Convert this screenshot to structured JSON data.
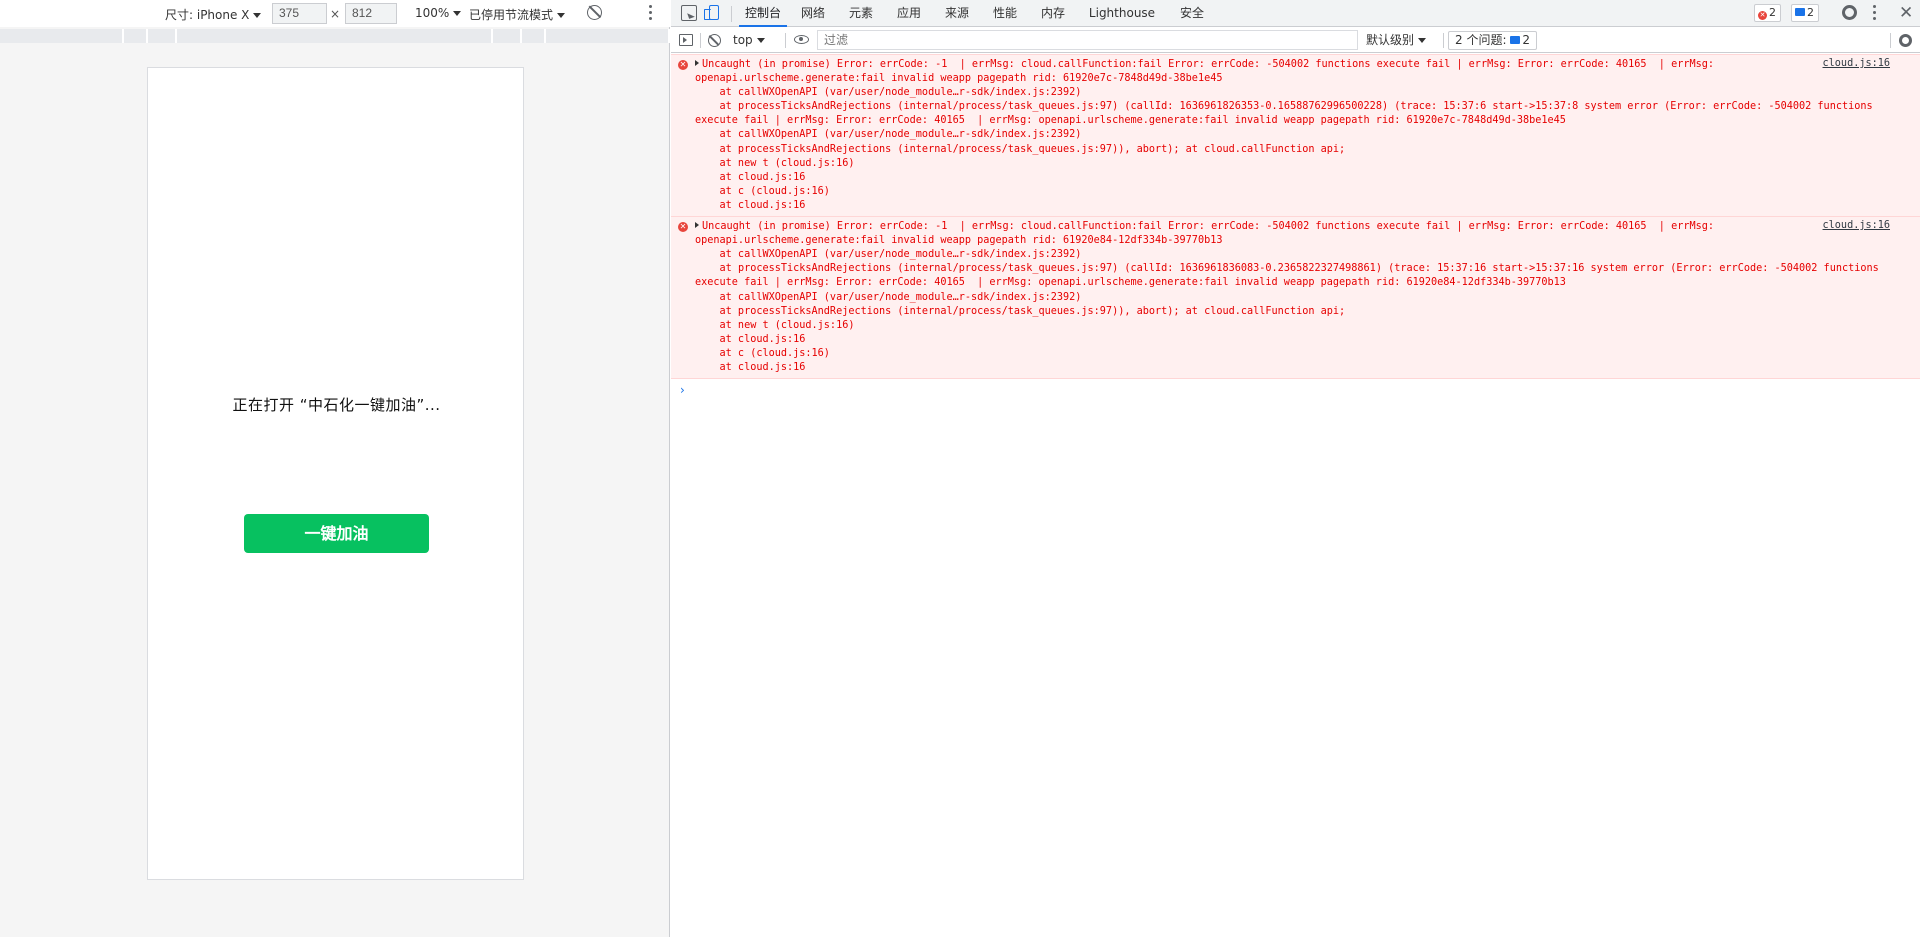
{
  "device_toolbar": {
    "dimensions_label": "尺寸: iPhone X",
    "width": "375",
    "height": "812",
    "times": "×",
    "zoom": "100%",
    "throttle": "已停用节流模式"
  },
  "phone": {
    "loading_text": "正在打开 “中石化一键加油”...",
    "button_label": "一键加油",
    "button_color": "#07c160"
  },
  "devtools": {
    "tabs": [
      "控制台",
      "网络",
      "元素",
      "应用",
      "来源",
      "性能",
      "内存",
      "Lighthouse",
      "安全"
    ],
    "active_tab": "控制台",
    "error_count": "2",
    "message_count": "2"
  },
  "console_toolbar": {
    "context": "top",
    "filter_placeholder": "过滤",
    "level": "默认级别",
    "issues_label": "2 个问题:",
    "issues_count": "2"
  },
  "console": {
    "messages": [
      {
        "source": "cloud.js:16",
        "lines": [
          "Uncaught (in promise) Error: errCode: -1  | errMsg: cloud.callFunction:fail Error: errCode: -504002 functions execute fail | errMsg: Error: errCode: 40165  | errMsg: openapi.urlscheme.generate:fail invalid weapp pagepath rid: 61920e7c-7848d49d-38be1e45",
          "    at callWXOpenAPI (var/user/node_module…r-sdk/index.js:2392)",
          "    at processTicksAndRejections (internal/process/task_queues.js:97) (callId: 1636961826353-0.16588762996500228) (trace: 15:37:6 start->15:37:8 system error (Error: errCode: -504002 functions execute fail | errMsg: Error: errCode: 40165  | errMsg: openapi.urlscheme.generate:fail invalid weapp pagepath rid: 61920e7c-7848d49d-38be1e45",
          "    at callWXOpenAPI (var/user/node_module…r-sdk/index.js:2392)",
          "    at processTicksAndRejections (internal/process/task_queues.js:97)), abort); at cloud.callFunction api;",
          "    at new t (cloud.js:16)",
          "    at cloud.js:16",
          "    at c (cloud.js:16)",
          "    at cloud.js:16"
        ]
      },
      {
        "source": "cloud.js:16",
        "lines": [
          "Uncaught (in promise) Error: errCode: -1  | errMsg: cloud.callFunction:fail Error: errCode: -504002 functions execute fail | errMsg: Error: errCode: 40165  | errMsg: openapi.urlscheme.generate:fail invalid weapp pagepath rid: 61920e84-12df334b-39770b13",
          "    at callWXOpenAPI (var/user/node_module…r-sdk/index.js:2392)",
          "    at processTicksAndRejections (internal/process/task_queues.js:97) (callId: 1636961836083-0.2365822327498861) (trace: 15:37:16 start->15:37:16 system error (Error: errCode: -504002 functions execute fail | errMsg: Error: errCode: 40165  | errMsg: openapi.urlscheme.generate:fail invalid weapp pagepath rid: 61920e84-12df334b-39770b13",
          "    at callWXOpenAPI (var/user/node_module…r-sdk/index.js:2392)",
          "    at processTicksAndRejections (internal/process/task_queues.js:97)), abort); at cloud.callFunction api;",
          "    at new t (cloud.js:16)",
          "    at cloud.js:16",
          "    at c (cloud.js:16)",
          "    at cloud.js:16"
        ]
      }
    ],
    "prompt": "›"
  }
}
